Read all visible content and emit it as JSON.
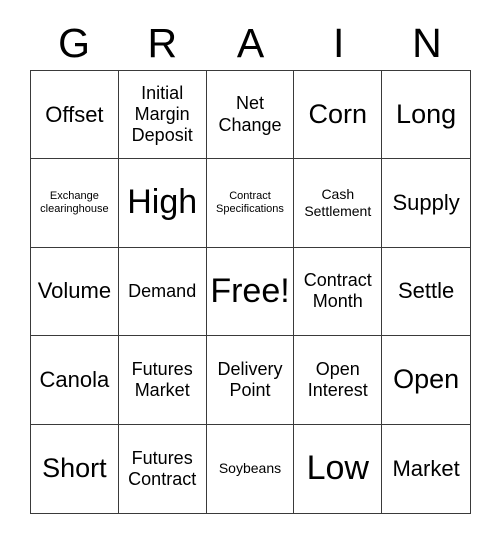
{
  "card": {
    "header_letters": [
      "G",
      "R",
      "A",
      "I",
      "N"
    ],
    "cells": [
      {
        "label": "Offset",
        "size": "lg"
      },
      {
        "label": "Initial Margin Deposit",
        "size": "md"
      },
      {
        "label": "Net Change",
        "size": "md"
      },
      {
        "label": "Corn",
        "size": "xl"
      },
      {
        "label": "Long",
        "size": "xl"
      },
      {
        "label": "Exchange clearinghouse",
        "size": "xs"
      },
      {
        "label": "High",
        "size": "xxl"
      },
      {
        "label": "Contract Specifications",
        "size": "xs"
      },
      {
        "label": "Cash Settlement",
        "size": "sm"
      },
      {
        "label": "Supply",
        "size": "lg"
      },
      {
        "label": "Volume",
        "size": "lg"
      },
      {
        "label": "Demand",
        "size": "md"
      },
      {
        "label": "Free!",
        "size": "xxl"
      },
      {
        "label": "Contract Month",
        "size": "md"
      },
      {
        "label": "Settle",
        "size": "lg"
      },
      {
        "label": "Canola",
        "size": "lg"
      },
      {
        "label": "Futures Market",
        "size": "md"
      },
      {
        "label": "Delivery Point",
        "size": "md"
      },
      {
        "label": "Open Interest",
        "size": "md"
      },
      {
        "label": "Open",
        "size": "xl"
      },
      {
        "label": "Short",
        "size": "xl"
      },
      {
        "label": "Futures Contract",
        "size": "md"
      },
      {
        "label": "Soybeans",
        "size": "sm"
      },
      {
        "label": "Low",
        "size": "xxl"
      },
      {
        "label": "Market",
        "size": "lg"
      }
    ]
  },
  "colors": {
    "border": "#3a3a3a",
    "text": "#000000",
    "background": "#ffffff"
  }
}
